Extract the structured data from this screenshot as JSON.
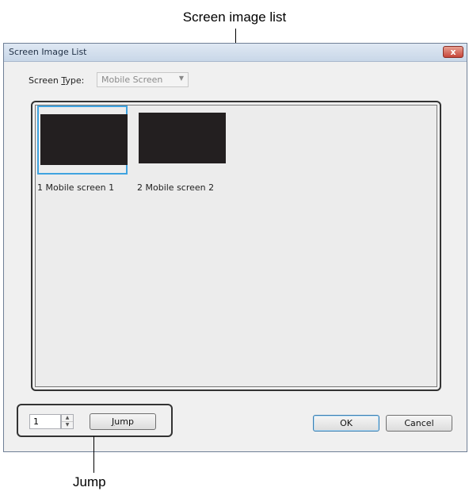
{
  "callouts": {
    "screen_image_list": "Screen image list",
    "jump": "Jump"
  },
  "dialog": {
    "title": "Screen Image List",
    "close_glyph": "x"
  },
  "screen_type": {
    "label_before": "Screen ",
    "label_mnemonic": "T",
    "label_after": "ype:",
    "value": "Mobile Screen",
    "arrow": "▼"
  },
  "thumbnails": [
    {
      "label": "1 Mobile screen 1",
      "selected": true
    },
    {
      "label": "2 Mobile screen 2",
      "selected": false
    }
  ],
  "jump_control": {
    "value": "1",
    "up": "▲",
    "down": "▼",
    "button_label": "Jump"
  },
  "buttons": {
    "ok": "OK",
    "cancel": "Cancel"
  }
}
